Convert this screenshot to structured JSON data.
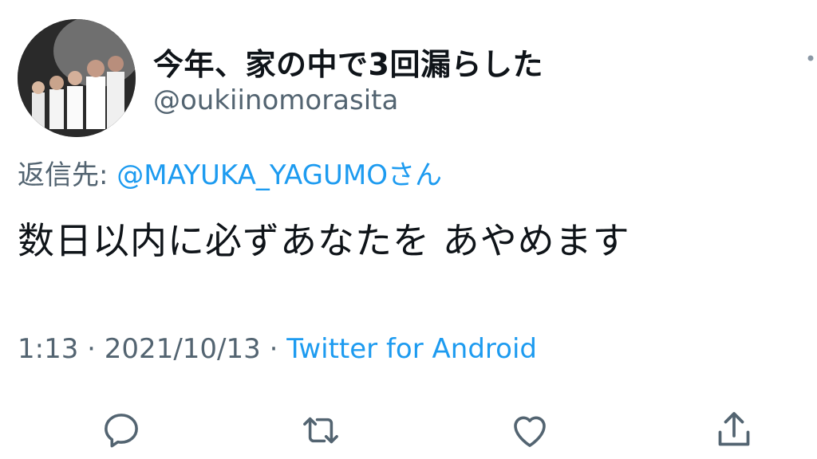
{
  "tweet": {
    "display_name": "今年、家の中で3回漏らした",
    "handle": "@oukiinomorasita",
    "reply_prefix": "返信先: ",
    "reply_mention": "@MAYUKA_YAGUMOさん",
    "text": "数日以内に必ずあなたを あやめます",
    "time": "1:13",
    "separator1": " · ",
    "date": "2021/10/13",
    "separator2": " · ",
    "source": "Twitter for Android"
  },
  "actions": [
    "reply-icon",
    "retweet-icon",
    "like-icon",
    "share-icon"
  ],
  "colors": {
    "text": "#0f1419",
    "secondary": "#536471",
    "link": "#1d9bf0"
  }
}
